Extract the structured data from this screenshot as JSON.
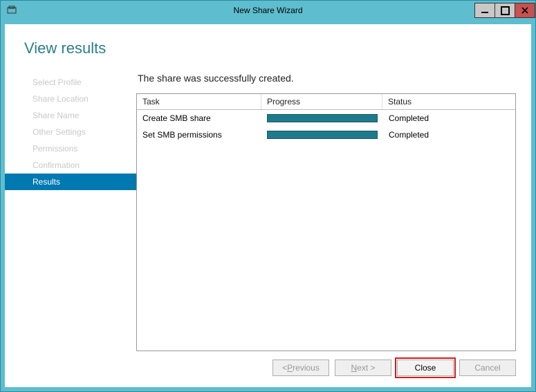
{
  "window": {
    "title": "New Share Wizard"
  },
  "page": {
    "heading": "View results",
    "resultMessage": "The share was successfully created."
  },
  "sidebar": {
    "items": [
      {
        "label": "Select Profile",
        "active": false
      },
      {
        "label": "Share Location",
        "active": false
      },
      {
        "label": "Share Name",
        "active": false
      },
      {
        "label": "Other Settings",
        "active": false
      },
      {
        "label": "Permissions",
        "active": false
      },
      {
        "label": "Confirmation",
        "active": false
      },
      {
        "label": "Results",
        "active": true
      }
    ]
  },
  "grid": {
    "headers": {
      "task": "Task",
      "progress": "Progress",
      "status": "Status"
    },
    "rows": [
      {
        "task": "Create SMB share",
        "status": "Completed",
        "progress": 100
      },
      {
        "task": "Set SMB permissions",
        "status": "Completed",
        "progress": 100
      }
    ]
  },
  "footer": {
    "previous_prefix": "< ",
    "previous_ukey": "P",
    "previous_rest": "revious",
    "next_ukey": "N",
    "next_rest": "ext >",
    "close": "Close",
    "cancel": "Cancel"
  }
}
